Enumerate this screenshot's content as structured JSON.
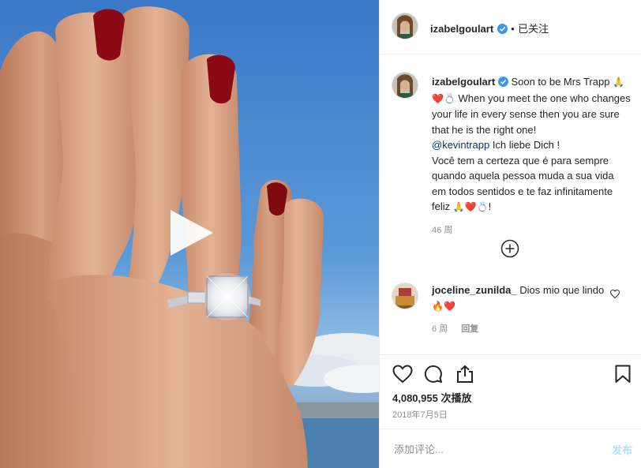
{
  "header": {
    "username": "izabelgoulart",
    "separator": "•",
    "follow_status": "已关注"
  },
  "caption": {
    "username": "izabelgoulart",
    "text_line1": "Soon to be Mrs Trapp",
    "emojis1": "🙏❤️💍",
    "text_line2": "When you meet the one who changes your life in every sense then you are sure that he is the right one!",
    "mention": "@kevintrapp",
    "text_line3": "Ich liebe Dich !",
    "text_portuguese": "Você tem a certeza que é para sempre quando aquela pessoa muda a sua vida em todos sentidos e te faz infinitamente feliz",
    "emojis2": "🙏❤️💍",
    "ending": "!",
    "time": "46 周"
  },
  "comments": [
    {
      "username": "joceline_zunilda_",
      "text": "Dios mio que lindo",
      "emojis": "🔥❤️",
      "time": "6 周",
      "reply_label": "回复"
    }
  ],
  "stats": {
    "views": "4,080,955 次播放",
    "date": "2018年7月5日"
  },
  "comment_input": {
    "placeholder": "添加评论...",
    "post_label": "发布"
  },
  "colors": {
    "verified": "#3897f0",
    "link": "#00376b",
    "post_disabled": "#b2dffc",
    "muted": "#8e8e8e"
  },
  "icons": [
    "play-icon",
    "verified-icon",
    "add-circle-icon",
    "heart-icon",
    "comment-icon",
    "share-icon",
    "bookmark-icon"
  ]
}
